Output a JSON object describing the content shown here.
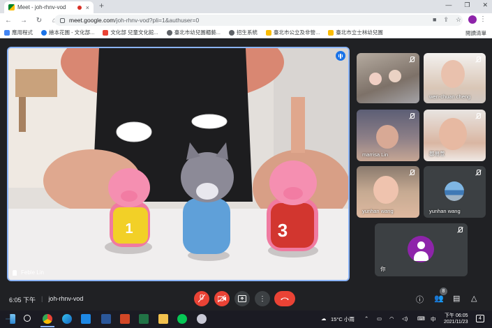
{
  "browser": {
    "tab_title": "Meet - joh-rhnv-vod",
    "tab_close": "×",
    "new_tab": "+",
    "window_controls": [
      "—",
      "❐",
      "✕"
    ],
    "nav": {
      "back": "←",
      "forward": "→",
      "reload": "↻",
      "home": "⌂"
    },
    "url_host": "meet.google.com",
    "url_path": "/joh-rhnv-vod?pli=1&authuser=0",
    "bookmarks": [
      {
        "label": "應用程式",
        "color": "#4285f4"
      },
      {
        "label": "繪本花園 - 文化部...",
        "color": "#1a73e8"
      },
      {
        "label": "文化部 兒童文化館...",
        "color": "#ea4335"
      },
      {
        "label": "臺北市幼兒園櫃藝...",
        "color": "#5f6368"
      },
      {
        "label": "招生系統",
        "color": "#5f6368"
      },
      {
        "label": "臺北市公立及非營...",
        "color": "#fbbc04"
      },
      {
        "label": "臺北市立士林幼兒園",
        "color": "#fbbc04"
      }
    ],
    "reading_list": "閱讀清單"
  },
  "meeting": {
    "main_speaker": "Feble Lin",
    "participants": [
      {
        "name": "",
        "muted": true
      },
      {
        "name": "wen-chuan cheng",
        "muted": true
      },
      {
        "name": "marrisa Lin",
        "muted": true
      },
      {
        "name": "鄒易萱",
        "muted": true
      },
      {
        "name": "yunhan wang",
        "muted": true
      },
      {
        "name": "yunhan wang",
        "muted": true
      },
      {
        "name": "你",
        "muted": true
      }
    ],
    "toy_numbers": [
      "1",
      "3"
    ]
  },
  "meetbar": {
    "time": "6:05 下午",
    "separator": "|",
    "meeting_code": "joh-rhnv-vod",
    "people_count": "8",
    "icons": {
      "mic": "mic-off",
      "cam": "camera-off",
      "present": "present-now",
      "more": "⋮",
      "end": "end-call"
    }
  },
  "taskbar": {
    "weather": "15°C 小雨",
    "ime": "中",
    "time": "下午 06:05",
    "date": "2021/11/23",
    "notifications": "4"
  }
}
